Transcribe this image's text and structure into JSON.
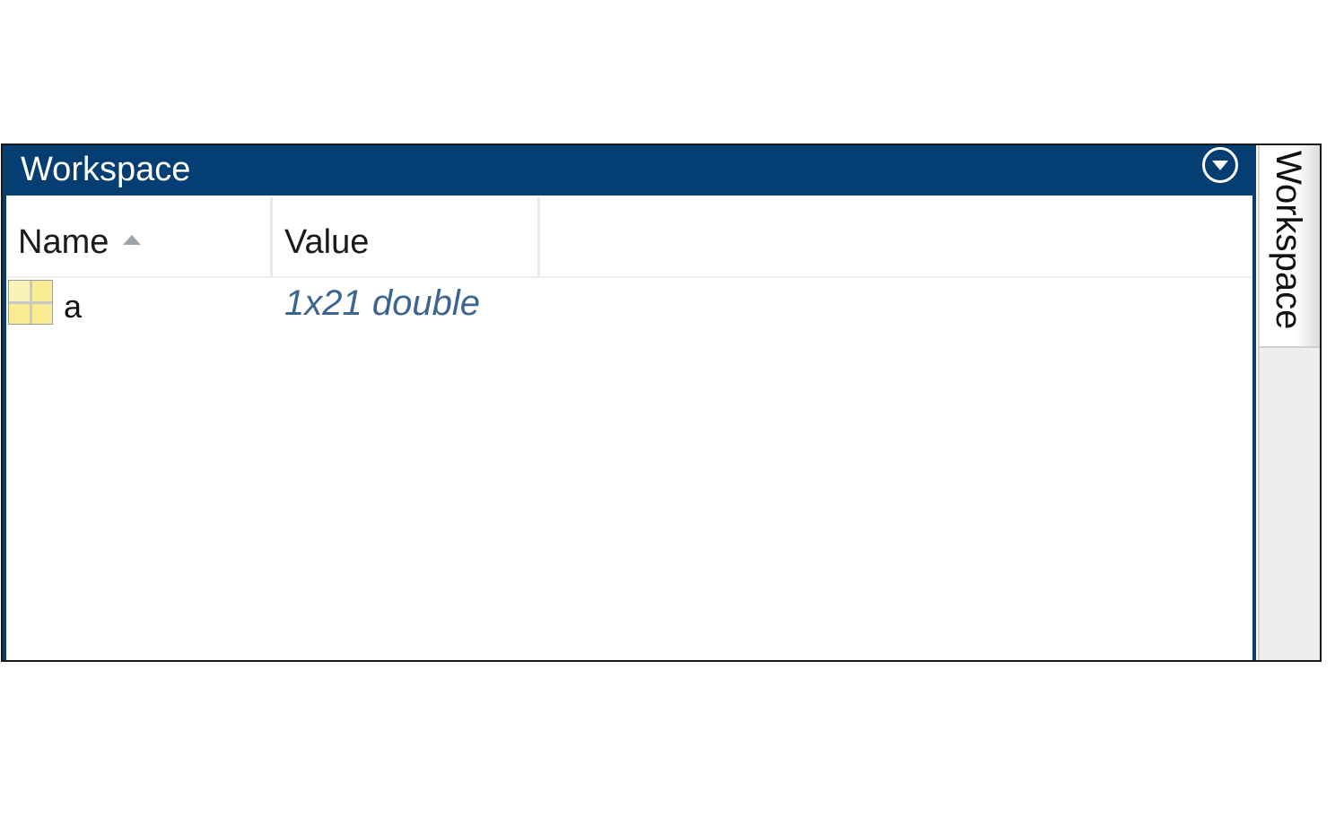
{
  "panel": {
    "title": "Workspace",
    "accent_color": "#043e72",
    "menu_icon": "circle-down-arrow-icon"
  },
  "table": {
    "columns": [
      {
        "label": "Name",
        "sort": "ascending"
      },
      {
        "label": "Value"
      },
      {
        "label": ""
      }
    ],
    "rows": [
      {
        "icon": "matrix-variable-icon",
        "name": "a",
        "value": "1x21 double"
      }
    ]
  },
  "side_tab": {
    "label": "Workspace"
  }
}
